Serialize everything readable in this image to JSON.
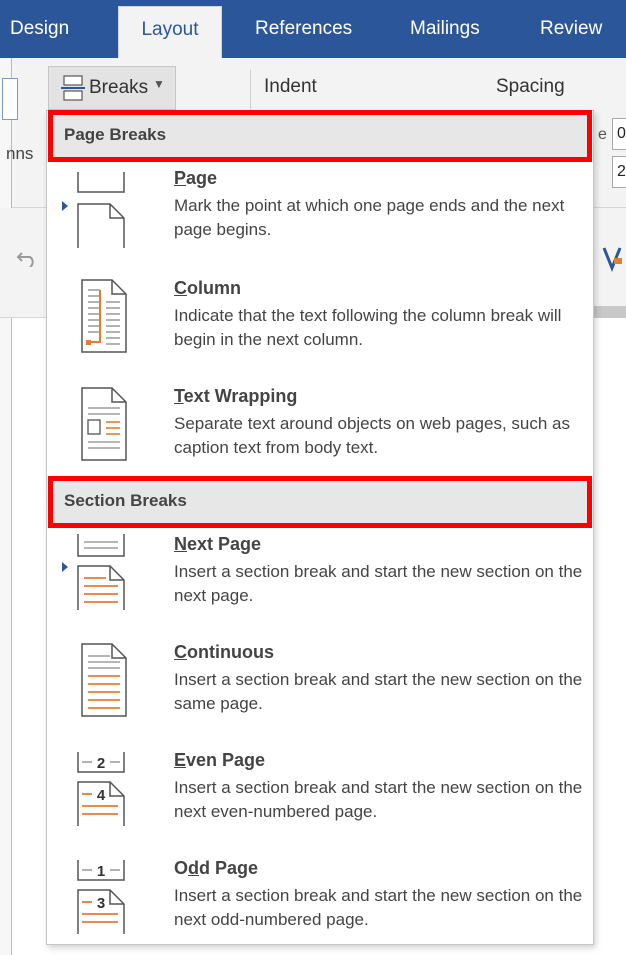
{
  "ribbon": {
    "tabs": [
      {
        "label": "Design"
      },
      {
        "label": "Layout",
        "active": true
      },
      {
        "label": "References"
      },
      {
        "label": "Mailings"
      },
      {
        "label": "Review"
      }
    ],
    "breaks_label": "Breaks",
    "columns_partial": "nns",
    "indent_label": "Indent",
    "spacing_label": "Spacing",
    "spin_label": "e",
    "spin_before": "0",
    "spin_after": "2"
  },
  "menu": {
    "page_breaks_header": "Page Breaks",
    "section_breaks_header": "Section Breaks",
    "items": [
      {
        "title": "Page",
        "accel": "P",
        "rest": "age",
        "desc": "Mark the point at which one page ends and the next page begins.",
        "icon": "page-break-icon"
      },
      {
        "title": "Column",
        "accel": "C",
        "rest": "olumn",
        "desc": "Indicate that the text following the column break will begin in the next column.",
        "icon": "column-break-icon"
      },
      {
        "title": "Text Wrapping",
        "accel": "T",
        "rest": "ext Wrapping",
        "desc": "Separate text around objects on web pages, such as caption text from body text.",
        "icon": "text-wrapping-icon"
      },
      {
        "title": "Next Page",
        "accel": "N",
        "rest": "ext Page",
        "desc": "Insert a section break and start the new section on the next page.",
        "icon": "next-page-icon"
      },
      {
        "title": "Continuous",
        "accel": "C",
        "rest": "ontinuous",
        "desc": "Insert a section break and start the new section on the same page.",
        "icon": "continuous-icon"
      },
      {
        "title": "Even Page",
        "accel": "E",
        "rest": "ven Page",
        "desc": "Insert a section break and start the new section on the next even-numbered page.",
        "icon": "even-page-icon",
        "num_top": "2",
        "num_bottom": "4"
      },
      {
        "title": "Odd Page",
        "pre": "O",
        "accel": "d",
        "rest": "d Page",
        "desc": "Insert a section break and start the new section on the next odd-numbered page.",
        "icon": "odd-page-icon",
        "num_top": "1",
        "num_bottom": "3"
      }
    ]
  },
  "colors": {
    "ribbon_blue": "#2b579a",
    "highlight_red": "#ff0000",
    "break_orange": "#e57c2e"
  }
}
